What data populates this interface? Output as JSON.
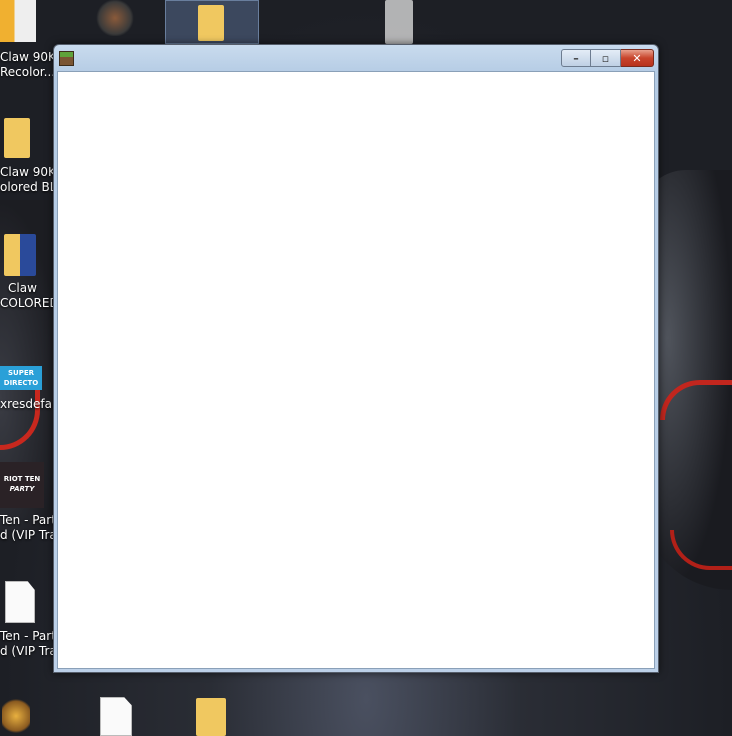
{
  "desktop": {
    "icons": [
      {
        "label_lines": [
          "Claw 90K",
          "Recolor..."
        ],
        "type": "zip"
      },
      {
        "label_lines": [
          "Claw 90K",
          "olored BLU"
        ],
        "type": "folder"
      },
      {
        "label_lines": [
          "Claw",
          "COLORED"
        ],
        "type": "folder"
      },
      {
        "label_lines": [
          "xresdefaul"
        ],
        "type": "image",
        "image_text": [
          "SUPER",
          "DIRECTO"
        ]
      },
      {
        "label_lines": [
          "Ten - Part",
          "d (VIP Tra."
        ],
        "type": "image",
        "image_text": [
          "RIOT TEN",
          "PARTY"
        ]
      },
      {
        "label_lines": [
          "Ten - Part",
          "d (VIP Tra."
        ],
        "type": "file"
      }
    ]
  },
  "window": {
    "title": "",
    "buttons": {
      "minimize": "–",
      "maximize": "▫",
      "close": "✕"
    }
  }
}
